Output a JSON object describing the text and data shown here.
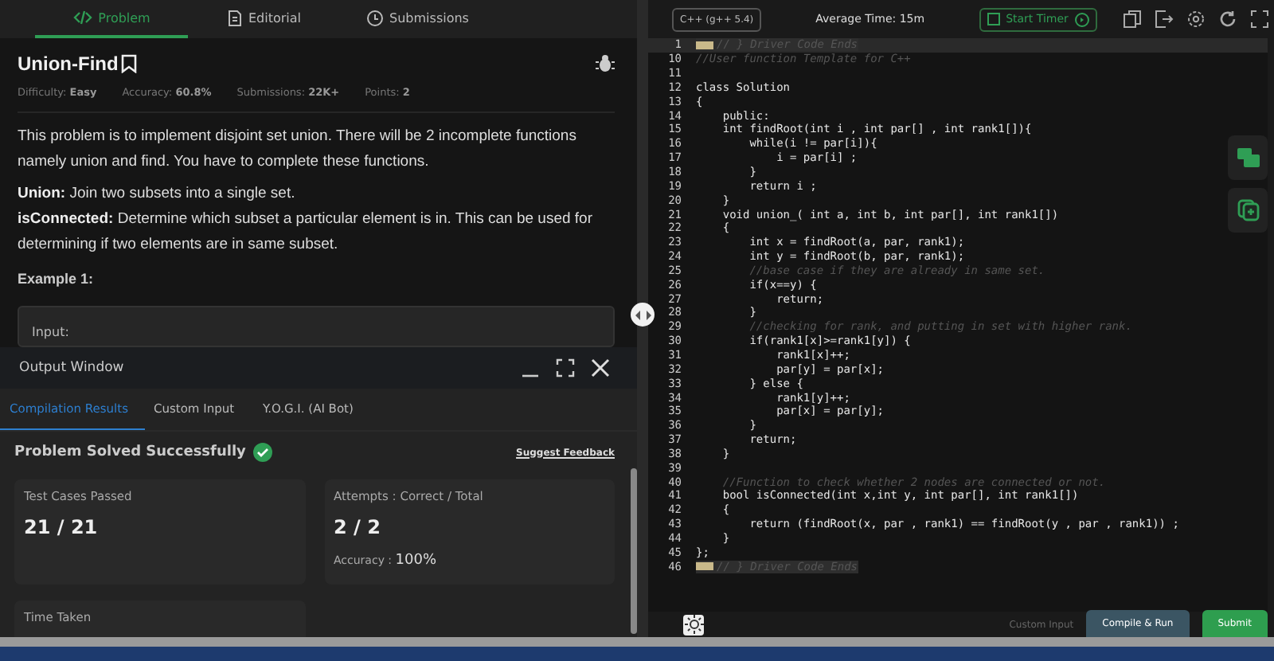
{
  "problem_tabs": [
    {
      "label": "Problem",
      "selected": true
    },
    {
      "label": "Editorial",
      "selected": false
    },
    {
      "label": "Submissions",
      "selected": false
    }
  ],
  "problem": {
    "title": "Union-Find",
    "meta": [
      {
        "label": "Difficulty: ",
        "value": "Easy"
      },
      {
        "label": "Accuracy: ",
        "value": "60.8%"
      },
      {
        "label": "Submissions: ",
        "value": "22K+"
      },
      {
        "label": "Points: ",
        "value": "2"
      }
    ],
    "paragraphs": [
      "This problem is to implement disjoint set union. There will be 2 incomplete functions namely union and find. You have to complete these functions."
    ],
    "definitions": [
      "**Union:** Join two subsets into a single set.",
      "**isConnected:** Determine which subset a particular element is in. This can be used for determining if two elements are in same subset."
    ],
    "example_heading": "Example 1:",
    "example_label": "Input:"
  },
  "output_window": {
    "title": "Output Window",
    "tabs": [
      {
        "label": "Compilation Results",
        "selected": true
      },
      {
        "label": "Custom Input",
        "selected": false
      },
      {
        "label": "Y.O.G.I. (AI Bot)",
        "selected": false
      }
    ],
    "status": "Problem Solved Successfully",
    "feedback_link": "Suggest Feedback",
    "cards": [
      {
        "label": "Test Cases Passed",
        "value": "21 / 21"
      },
      {
        "label": "Attempts : Correct / Total",
        "value": "2 / 2",
        "extra_label": "Accuracy : ",
        "extra_value": "100%"
      },
      {
        "label": "Time Taken"
      }
    ]
  },
  "editor": {
    "language": "C++ (g++ 5.4)",
    "average_time": "Average Time: 15m",
    "timer_button": "Start Timer",
    "lines": [
      {
        "number": "1",
        "text": "// } Driver Code Ends",
        "kind": "folded"
      },
      {
        "number": "10",
        "text": "//User function Template for C++",
        "kind": "comment"
      },
      {
        "number": "11",
        "kind": "code"
      },
      {
        "number": "12",
        "text": "class Solution",
        "kind": "code"
      },
      {
        "number": "13",
        "text": "{",
        "kind": "code"
      },
      {
        "number": "14",
        "text": "    public:",
        "kind": "code"
      },
      {
        "number": "15",
        "text": "    int findRoot(int i , int par[] , int rank1[]){",
        "kind": "code"
      },
      {
        "number": "16",
        "text": "        while(i != par[i]){",
        "kind": "code"
      },
      {
        "number": "17",
        "text": "            i = par[i] ;",
        "kind": "code"
      },
      {
        "number": "18",
        "text": "        }",
        "kind": "code"
      },
      {
        "number": "19",
        "text": "        return i ;",
        "kind": "code"
      },
      {
        "number": "20",
        "text": "    }",
        "kind": "code"
      },
      {
        "number": "21",
        "text": "    void union_( int a, int b, int par[], int rank1[])",
        "kind": "code"
      },
      {
        "number": "22",
        "text": "    {",
        "kind": "code"
      },
      {
        "number": "23",
        "text": "        int x = findRoot(a, par, rank1);",
        "kind": "code"
      },
      {
        "number": "24",
        "text": "        int y = findRoot(b, par, rank1);",
        "kind": "code"
      },
      {
        "number": "25",
        "text": "        //base case if they are already in same set.",
        "kind": "comment"
      },
      {
        "number": "26",
        "text": "        if(x==y) {",
        "kind": "code"
      },
      {
        "number": "27",
        "text": "            return;",
        "kind": "code"
      },
      {
        "number": "28",
        "text": "        }",
        "kind": "code"
      },
      {
        "number": "29",
        "text": "        //checking for rank, and putting in set with higher rank.",
        "kind": "comment"
      },
      {
        "number": "30",
        "text": "        if(rank1[x]>=rank1[y]) {",
        "kind": "code"
      },
      {
        "number": "31",
        "text": "            rank1[x]++;",
        "kind": "code"
      },
      {
        "number": "32",
        "text": "            par[y] = par[x];",
        "kind": "code"
      },
      {
        "number": "33",
        "text": "        } else {",
        "kind": "code"
      },
      {
        "number": "34",
        "text": "            rank1[y]++;",
        "kind": "code"
      },
      {
        "number": "35",
        "text": "            par[x] = par[y];",
        "kind": "code"
      },
      {
        "number": "36",
        "text": "        }",
        "kind": "code"
      },
      {
        "number": "37",
        "text": "        return;",
        "kind": "code"
      },
      {
        "number": "38",
        "text": "    }",
        "kind": "code"
      },
      {
        "number": "39",
        "kind": "code"
      },
      {
        "number": "40",
        "text": "    //Function to check whether 2 nodes are connected or not.",
        "kind": "comment"
      },
      {
        "number": "41",
        "text": "    bool isConnected(int x,int y, int par[], int rank1[])",
        "kind": "code"
      },
      {
        "number": "42",
        "text": "    {",
        "kind": "code"
      },
      {
        "number": "43",
        "text": "        return (findRoot(x, par , rank1) == findRoot(y , par , rank1)) ;",
        "kind": "code"
      },
      {
        "number": "44",
        "text": "    }",
        "kind": "code"
      },
      {
        "number": "45",
        "text": "};",
        "kind": "code"
      },
      {
        "number": "46",
        "text": "// } Driver Code Ends",
        "kind": "folded"
      }
    ],
    "custom_input": "Custom Input",
    "compile_button": "Compile & Run",
    "submit_button": "Submit"
  }
}
